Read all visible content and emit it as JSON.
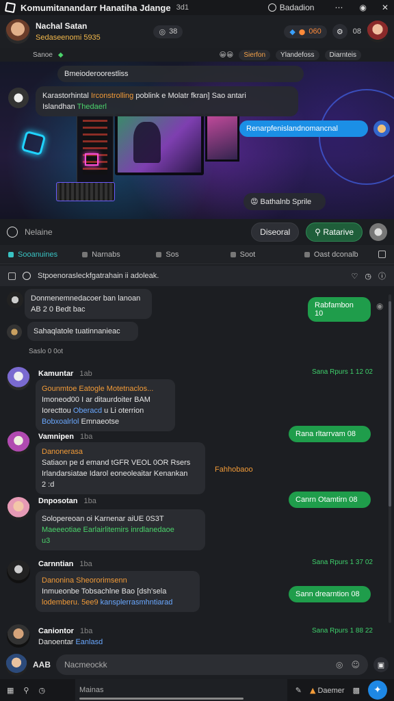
{
  "app": {
    "title": "Komumitanandarr Hanatiha Jdange",
    "title_suffix": "3d1",
    "status_label": "Badadion"
  },
  "channel": {
    "name": "Nachal Satan",
    "subtitle": "Sedaseenomi 5935",
    "member_count": "38",
    "badge_value": "060",
    "extra_count": "08"
  },
  "chips": {
    "left_label": "Sanoe",
    "orange_label": "Sierfon",
    "chip2": "Ylandefoss",
    "chip3": "Diarnteis"
  },
  "hero": {
    "pinned_msg": "Bmeioderoorestliss",
    "msg1_line1_a": "Karastorhintal",
    "msg1_line1_b": "Irconstrolling",
    "msg1_line1_c": "poblink e Molatr fkran]",
    "msg1_line1_d": "Sao antari",
    "msg1_line2_a": "Islandhan",
    "msg1_line2_b": "Thedaerl",
    "blue_msg": "Renarpfenislandnomancnal",
    "dark_msg": "Bathalnb Sprile",
    "input_placeholder": "Nelaine",
    "btn_primary": "Diseoral",
    "btn_secondary": "Ratarive"
  },
  "tabs": [
    {
      "label": "Sooanuines"
    },
    {
      "label": "Narnabs"
    },
    {
      "label": "Sos"
    },
    {
      "label": "Soot"
    },
    {
      "label": "Oast dconalb"
    }
  ],
  "thread": {
    "topic": "Stpoenorasleckfgatrahain ii adoleak."
  },
  "feed": {
    "sys1_line1": "Donmenemnedacoer ban lanoan",
    "sys1_line2": "AB 2 0 Bedt bac",
    "sys2": "Sahaqlatole tuatinnanieac",
    "sys2_meta": "Saslo 0 0ot",
    "green_right1": "Rabfambon 10",
    "messages": [
      {
        "sender": "Kamuntar",
        "time": "1ab",
        "line1": "Gounmtoe Eatogle Motetnaclos...",
        "line2": "Imoneod00 I ar ditaurdoiter BAM",
        "line3_a": "Iorecttou",
        "line3_b": "Oberacd",
        "line3_c": "u Li oterrion",
        "line4_a": "Bobxoalrlol",
        "line4_b": "Emnaeotse",
        "right_ts": "Sana Rpurs 1 12  02",
        "right_msg": "Rana rltarrvam 08"
      },
      {
        "sender": "Vamnipen",
        "time": "1ba",
        "line1": "Danonerasa",
        "line2": "Satiaon pe d emand tGFR VEOL 0OR Rsers",
        "line3": "Irlandarsiatae Idarol eoneoleaitar Kenankan",
        "line3_b": "Fahhobaoo",
        "line4": "2 :d",
        "right_msg": "Canrn Otamtirn 08"
      },
      {
        "sender": "Dnposotan",
        "time": "1ba",
        "line1": "Solopereoan oi Karnenar aiUE 0S3T",
        "line2": "Maeeeotiae Earlairlitemirs inrdlanedaoe",
        "line3": "u3",
        "right_msg": "Canm dhentrorn 08",
        "right_ts": "Sana Rpurs 1 37  02"
      },
      {
        "sender": "Carnntian",
        "time": "1ba",
        "line1": "Danonina Sheororimsenn",
        "line2": "Inmueonbe Tobsachlne Bao [dsh'sela",
        "line3_a": "lodemberu. 5ee9",
        "line3_b": "kansplerrasmhntiarad",
        "right_msg": "Sann drearntion 08",
        "right_ts": "Sana Rpurs 1 88  22"
      },
      {
        "sender": "Caniontor",
        "time": "1ba",
        "line1_a": "Danoentar",
        "line1_b": "Eanlasd"
      }
    ]
  },
  "composer": {
    "user_label": "AAB",
    "placeholder": "Nacmeockk"
  },
  "bottombar": {
    "field": "Mainas",
    "right_label": "Daemer"
  },
  "colors": {
    "accent_teal": "#39c3c3",
    "accent_green": "#1f9d4b",
    "accent_blue": "#1b8fe6",
    "accent_orange": "#f29b38"
  }
}
